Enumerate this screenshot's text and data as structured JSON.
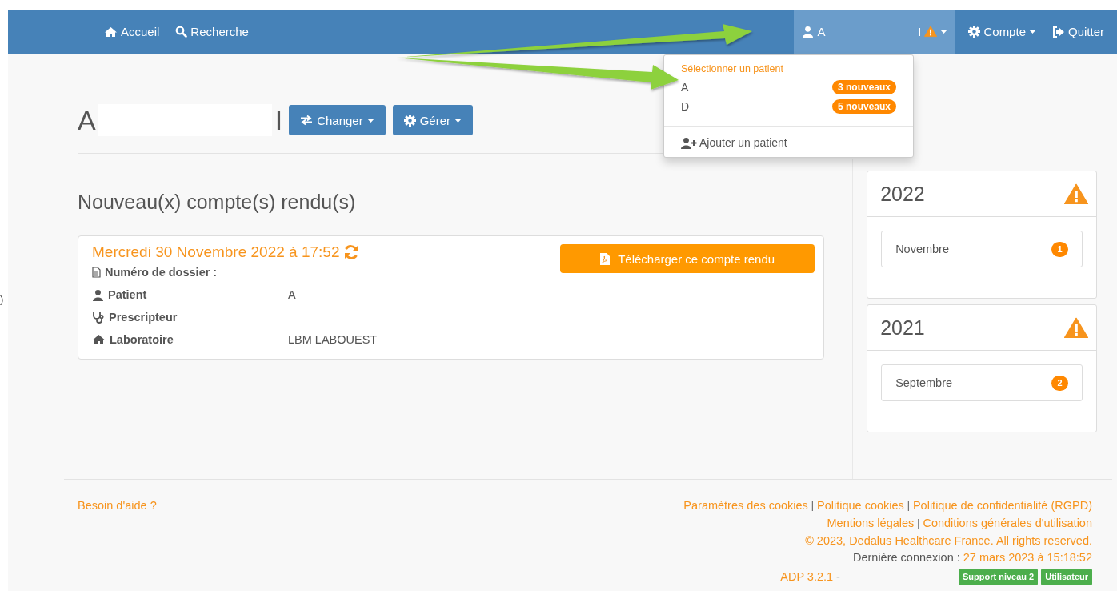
{
  "nav": {
    "items": [
      {
        "kind": "home",
        "label": "Accueil"
      },
      {
        "kind": "search",
        "label": "Recherche"
      }
    ],
    "patient": {
      "name_start": "A",
      "name_end": "I",
      "alert": true
    },
    "right": [
      {
        "kind": "settings",
        "label": "Compte",
        "dropdown": true
      },
      {
        "kind": "logout",
        "label": "Quitter",
        "dropdown": false
      }
    ]
  },
  "patient_menu": {
    "header": "Sélectionner un patient",
    "patients": [
      {
        "name": "A",
        "badge": "3 nouveaux"
      },
      {
        "name": "D",
        "badge": "5 nouveaux"
      }
    ],
    "add": "Ajouter un patient"
  },
  "page_header": {
    "name_start": "A",
    "name_end": "I",
    "buttons": [
      {
        "kind": "exchange",
        "label": "Changer"
      },
      {
        "kind": "settings",
        "label": "Gérer"
      }
    ]
  },
  "section_title": "Nouveau(x) compte(s) rendu(s)",
  "report": {
    "date": "Mercredi 30 Novembre 2022 à 17:52",
    "download": "Télécharger ce compte rendu",
    "fields": [
      {
        "kind": "file",
        "label": "Numéro de dossier :"
      },
      {
        "kind": "user",
        "label": "Patient",
        "value": "A"
      },
      {
        "kind": "stethoscope",
        "label": "Prescripteur"
      },
      {
        "kind": "home",
        "label": "Laboratoire",
        "value": "LBM LABOUEST"
      }
    ]
  },
  "years": [
    {
      "year": "2022",
      "alert": true,
      "months": [
        {
          "name": "Novembre",
          "count": "1"
        }
      ]
    },
    {
      "year": "2021",
      "alert": true,
      "months": [
        {
          "name": "Septembre",
          "count": "2"
        }
      ]
    }
  ],
  "footer": {
    "help": "Besoin d'aide ?",
    "separator": "|",
    "link_rows": [
      [
        "Paramètres des cookies",
        "Politique cookies",
        "Politique de confidentialité (RGPD)"
      ],
      [
        "Mentions légales",
        "Conditions générales d'utilisation"
      ]
    ],
    "copyright": "© 2023, Dedalus Healthcare France. All rights reserved.",
    "last_login_label": "Dernière connexion :",
    "last_login": "27 mars 2023 à 15:18:52",
    "version": "ADP 3.2.1",
    "version_sep": "-",
    "badges": [
      "Support niveau 2",
      "Utilisateur"
    ]
  },
  "edge_mark": ")"
}
